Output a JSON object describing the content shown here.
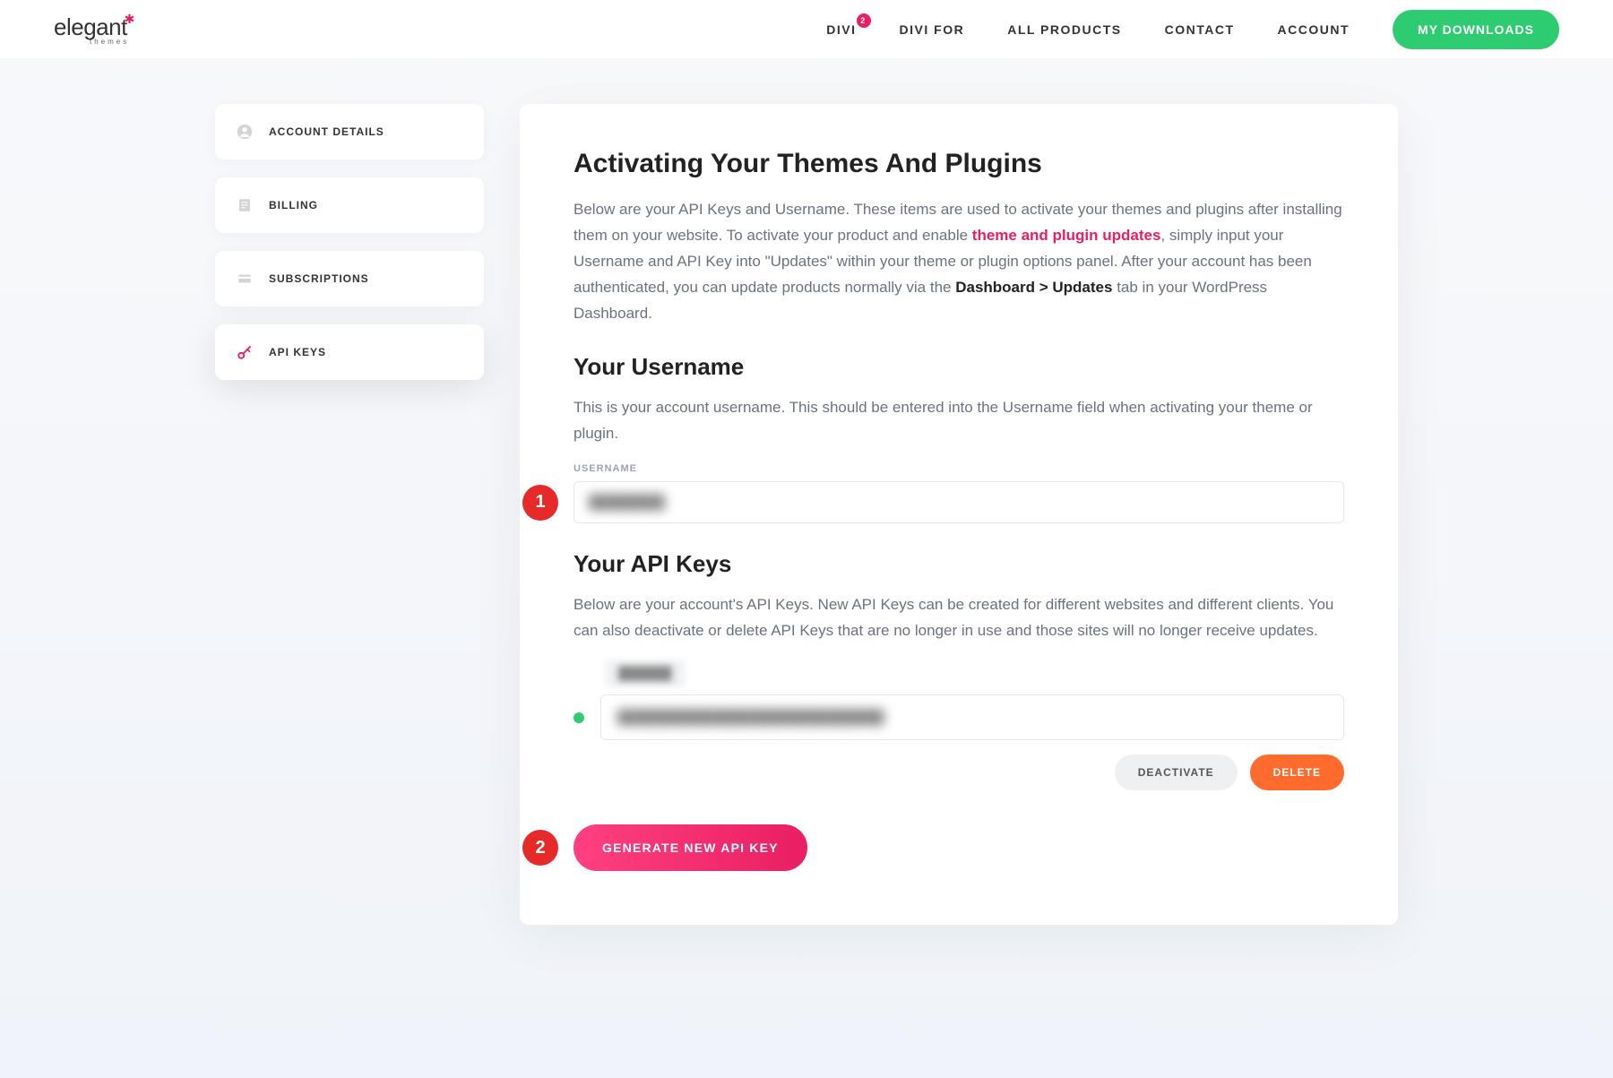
{
  "header": {
    "logo_text": "elegant",
    "logo_sub": "themes",
    "nav": [
      {
        "label": "DIVI",
        "badge": "2"
      },
      {
        "label": "DIVI FOR"
      },
      {
        "label": "ALL PRODUCTS"
      },
      {
        "label": "CONTACT"
      },
      {
        "label": "ACCOUNT"
      }
    ],
    "downloads_btn": "MY DOWNLOADS"
  },
  "sidebar": {
    "items": [
      {
        "label": "ACCOUNT DETAILS",
        "icon": "user-icon"
      },
      {
        "label": "BILLING",
        "icon": "billing-icon"
      },
      {
        "label": "SUBSCRIPTIONS",
        "icon": "card-icon"
      },
      {
        "label": "API KEYS",
        "icon": "key-icon",
        "active": true
      }
    ]
  },
  "main": {
    "title": "Activating Your Themes And Plugins",
    "intro_p1a": "Below are your API Keys and Username. These items are used to activate your themes and plugins after installing them on your website. To activate your product and enable ",
    "intro_link": "theme and plugin updates",
    "intro_p1b": ", simply input your Username and API Key into \"Updates\" within your theme or plugin options panel. After your account has been authenticated, you can update products normally via the ",
    "intro_bold": "Dashboard > Updates",
    "intro_p1c": " tab in your WordPress Dashboard.",
    "username_heading": "Your Username",
    "username_desc": "This is your account username. This should be entered into the Username field when activating your theme or plugin.",
    "username_label": "USERNAME",
    "username_value": "████████",
    "marker1": "1",
    "apikeys_heading": "Your API Keys",
    "apikeys_desc": "Below are your account's API Keys. New API Keys can be created for different websites and different clients. You can also deactivate or delete API Keys that are no longer in use and those sites will no longer receive updates.",
    "apikey_label": "██████",
    "apikey_value": "████████████████████████████",
    "deactivate_btn": "DEACTIVATE",
    "delete_btn": "DELETE",
    "marker2": "2",
    "generate_btn": "GENERATE NEW API KEY"
  }
}
